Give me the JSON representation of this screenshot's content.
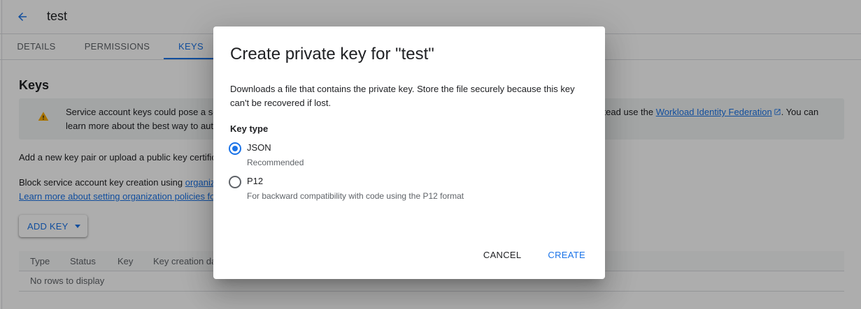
{
  "header": {
    "title": "test"
  },
  "tabs": [
    {
      "label": "DETAILS"
    },
    {
      "label": "PERMISSIONS"
    },
    {
      "label": "KEYS"
    }
  ],
  "keys_section": {
    "title": "Keys",
    "warning": {
      "text_start": "Service account keys could pose a security risk if compromised. We recommend you avoid downloading service account keys and instead use the ",
      "link_text": "Workload Identity Federation",
      "text_end": ". You can learn more about the best way to authenticate service accounts on Google Cloud here."
    },
    "add_text": "Add a new key pair or upload a public key certificate from an existing key pair.",
    "block_text": "Block service account key creation using ",
    "block_link": "organization policies",
    "learn_link": "Learn more about setting organization policies for service accounts",
    "add_key_button": "ADD KEY"
  },
  "table": {
    "columns": [
      "Type",
      "Status",
      "Key",
      "Key creation date"
    ],
    "empty_text": "No rows to display"
  },
  "dialog": {
    "title": "Create private key for \"test\"",
    "description": "Downloads a file that contains the private key. Store the file securely because this key can't be recovered if lost.",
    "key_type_label": "Key type",
    "options": [
      {
        "label": "JSON",
        "sub": "Recommended",
        "checked": true
      },
      {
        "label": "P12",
        "sub": "For backward compatibility with code using the P12 format",
        "checked": false
      }
    ],
    "cancel_label": "CANCEL",
    "create_label": "CREATE"
  },
  "colors": {
    "accent": "#1a73e8",
    "warning_icon": "#f9ab00",
    "scrim": "rgba(0,0,0,0.32)"
  },
  "icons": {
    "back": "arrow-left-icon",
    "warning": "warning-triangle-icon",
    "external_link": "external-link-icon",
    "dropdown": "caret-down-icon"
  }
}
